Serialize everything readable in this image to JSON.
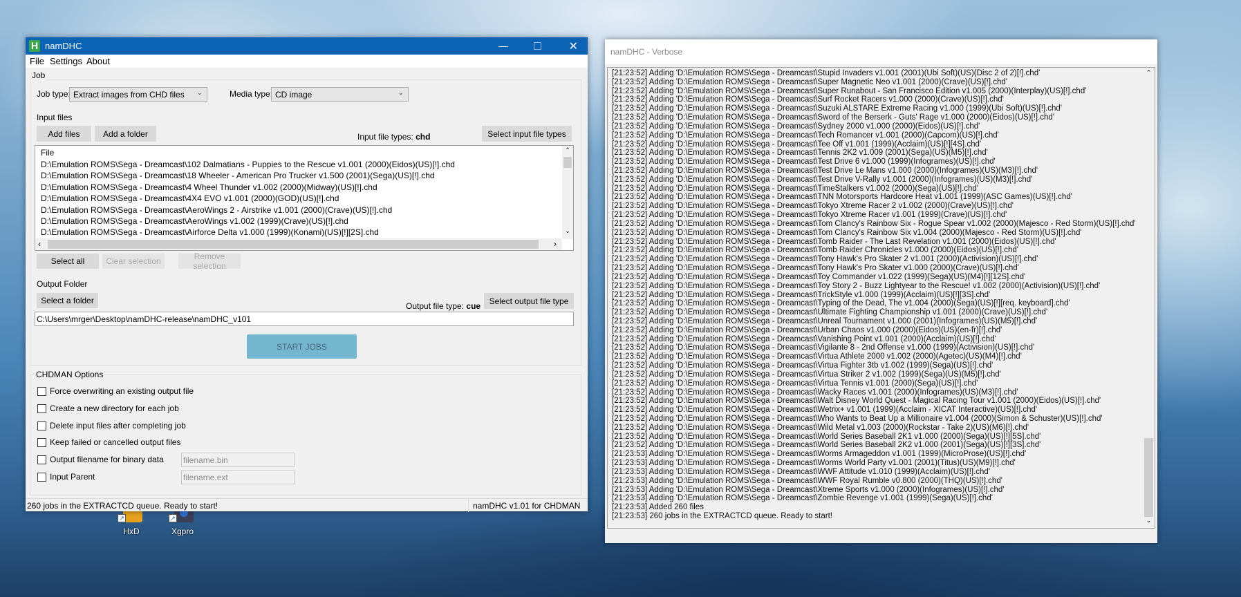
{
  "desktop": {
    "icons": [
      {
        "label": "HxD"
      },
      {
        "label": "Xgpro"
      }
    ]
  },
  "main": {
    "title": "namDHC",
    "app_icon_letter": "H",
    "menu": [
      "File",
      "Settings",
      "About"
    ],
    "job_group": "Job",
    "job_type_label": "Job type:",
    "job_type_value": "Extract images from CHD files",
    "media_type_label": "Media type:",
    "media_type_value": "CD image",
    "input_files_label": "Input files",
    "add_files": "Add files",
    "add_folder": "Add a folder",
    "input_types_label": "Input file types:",
    "input_types_value": "chd",
    "select_input_types": "Select input file types",
    "list_header": "File",
    "files": [
      "D:\\Emulation ROMS\\Sega - Dreamcast\\102 Dalmatians - Puppies to the Rescue v1.001 (2000)(Eidos)(US)[!].chd",
      "D:\\Emulation ROMS\\Sega - Dreamcast\\18 Wheeler - American Pro Trucker v1.500 (2001)(Sega)(US)[!].chd",
      "D:\\Emulation ROMS\\Sega - Dreamcast\\4 Wheel Thunder v1.002 (2000)(Midway)(US)[!].chd",
      "D:\\Emulation ROMS\\Sega - Dreamcast\\4X4 EVO v1.001 (2000)(GOD)(US)[!].chd",
      "D:\\Emulation ROMS\\Sega - Dreamcast\\AeroWings 2 - Airstrike v1.001 (2000)(Crave)(US)[!].chd",
      "D:\\Emulation ROMS\\Sega - Dreamcast\\AeroWings v1.002 (1999)(Crave)(US)[!].chd",
      "D:\\Emulation ROMS\\Sega - Dreamcast\\Airforce Delta v1.000 (1999)(Konami)(US)[!][2S].chd"
    ],
    "select_all": "Select all",
    "clear_selection": "Clear selection",
    "remove_selection": "Remove selection",
    "output_folder_label": "Output Folder",
    "select_folder": "Select a folder",
    "output_type_label": "Output file type:",
    "output_type_value": "cue",
    "select_output_type": "Select output file type",
    "output_path": "C:\\Users\\mrger\\Desktop\\namDHC-release\\namDHC_v101",
    "start_jobs": "START JOBS",
    "start_color": "#75b6cf",
    "options_group": "CHDMAN Options",
    "options": [
      {
        "label": "Force overwriting an existing output file",
        "checked": false
      },
      {
        "label": "Create a new directory for each job",
        "checked": false
      },
      {
        "label": "Delete input files after completing job",
        "checked": false
      },
      {
        "label": "Keep failed or cancelled output files",
        "checked": false
      },
      {
        "label": "Output filename for binary data",
        "checked": false,
        "field": "filename.bin"
      },
      {
        "label": "Input Parent",
        "checked": false,
        "field": "filename.ext"
      }
    ],
    "status_left": "260 jobs in the EXTRACTCD queue. Ready to start!",
    "status_right": "namDHC v1.01 for CHDMAN",
    "title_color": "#0b63b6"
  },
  "verbose": {
    "title": "namDHC - Verbose",
    "lines": [
      "[21:23:52]  Adding 'D:\\Emulation ROMS\\Sega - Dreamcast\\Stupid Invaders v1.001 (2001)(Ubi Soft)(US)(Disc 2 of 2)[!].chd'",
      "[21:23:52]  Adding 'D:\\Emulation ROMS\\Sega - Dreamcast\\Super Magnetic Neo v1.001 (2000)(Crave)(US)[!].chd'",
      "[21:23:52]  Adding 'D:\\Emulation ROMS\\Sega - Dreamcast\\Super Runabout - San Francisco Edition v1.005 (2000)(Interplay)(US)[!].chd'",
      "[21:23:52]  Adding 'D:\\Emulation ROMS\\Sega - Dreamcast\\Surf Rocket Racers v1.000 (2000)(Crave)(US)[!].chd'",
      "[21:23:52]  Adding 'D:\\Emulation ROMS\\Sega - Dreamcast\\Suzuki ALSTARE Extreme Racing v1.000 (1999)(Ubi Soft)(US)[!].chd'",
      "[21:23:52]  Adding 'D:\\Emulation ROMS\\Sega - Dreamcast\\Sword of the Berserk - Guts' Rage v1.000 (2000)(Eidos)(US)[!].chd'",
      "[21:23:52]  Adding 'D:\\Emulation ROMS\\Sega - Dreamcast\\Sydney 2000 v1.000 (2000)(Eidos)(US)[!].chd'",
      "[21:23:52]  Adding 'D:\\Emulation ROMS\\Sega - Dreamcast\\Tech Romancer v1.001 (2000)(Capcom)(US)[!].chd'",
      "[21:23:52]  Adding 'D:\\Emulation ROMS\\Sega - Dreamcast\\Tee Off v1.001 (1999)(Acclaim)(US)[!][4S].chd'",
      "[21:23:52]  Adding 'D:\\Emulation ROMS\\Sega - Dreamcast\\Tennis 2K2 v1.009 (2001)(Sega)(US)(M5)[!].chd'",
      "[21:23:52]  Adding 'D:\\Emulation ROMS\\Sega - Dreamcast\\Test Drive 6 v1.000 (1999)(Infogrames)(US)[!].chd'",
      "[21:23:52]  Adding 'D:\\Emulation ROMS\\Sega - Dreamcast\\Test Drive Le Mans v1.000 (2000)(Infogrames)(US)(M3)[!].chd'",
      "[21:23:52]  Adding 'D:\\Emulation ROMS\\Sega - Dreamcast\\Test Drive V-Rally v1.001 (2000)(Infogrames)(US)(M3)[!].chd'",
      "[21:23:52]  Adding 'D:\\Emulation ROMS\\Sega - Dreamcast\\TimeStalkers v1.002 (2000)(Sega)(US)[!].chd'",
      "[21:23:52]  Adding 'D:\\Emulation ROMS\\Sega - Dreamcast\\TNN Motorsports Hardcore Heat v1.001 (1999)(ASC Games)(US)[!].chd'",
      "[21:23:52]  Adding 'D:\\Emulation ROMS\\Sega - Dreamcast\\Tokyo Xtreme Racer 2 v1.002 (2000)(Crave)(US)[!].chd'",
      "[21:23:52]  Adding 'D:\\Emulation ROMS\\Sega - Dreamcast\\Tokyo Xtreme Racer v1.001 (1999)(Crave)(US)[!].chd'",
      "[21:23:52]  Adding 'D:\\Emulation ROMS\\Sega - Dreamcast\\Tom Clancy's Rainbow Six - Rogue Spear v1.002 (2000)(Majesco - Red Storm)(US)[!].chd'",
      "[21:23:52]  Adding 'D:\\Emulation ROMS\\Sega - Dreamcast\\Tom Clancy's Rainbow Six v1.004 (2000)(Majesco - Red Storm)(US)[!].chd'",
      "[21:23:52]  Adding 'D:\\Emulation ROMS\\Sega - Dreamcast\\Tomb Raider - The Last Revelation v1.001 (2000)(Eidos)(US)[!].chd'",
      "[21:23:52]  Adding 'D:\\Emulation ROMS\\Sega - Dreamcast\\Tomb Raider Chronicles v1.000 (2000)(Eidos)(US)[!].chd'",
      "[21:23:52]  Adding 'D:\\Emulation ROMS\\Sega - Dreamcast\\Tony Hawk's Pro Skater 2 v1.001 (2000)(Activision)(US)[!].chd'",
      "[21:23:52]  Adding 'D:\\Emulation ROMS\\Sega - Dreamcast\\Tony Hawk's Pro Skater v1.000 (2000)(Crave)(US)[!].chd'",
      "[21:23:52]  Adding 'D:\\Emulation ROMS\\Sega - Dreamcast\\Toy Commander v1.022 (1999)(Sega)(US)(M4)[!][12S].chd'",
      "[21:23:52]  Adding 'D:\\Emulation ROMS\\Sega - Dreamcast\\Toy Story 2 - Buzz Lightyear to the Rescue! v1.002 (2000)(Activision)(US)[!].chd'",
      "[21:23:52]  Adding 'D:\\Emulation ROMS\\Sega - Dreamcast\\TrickStyle v1.000 (1999)(Acclaim)(US)[!][3S].chd'",
      "[21:23:52]  Adding 'D:\\Emulation ROMS\\Sega - Dreamcast\\Typing of the Dead, The v1.004 (2000)(Sega)(US)[!][req. keyboard].chd'",
      "[21:23:52]  Adding 'D:\\Emulation ROMS\\Sega - Dreamcast\\Ultimate Fighting Championship v1.001 (2000)(Crave)(US)[!].chd'",
      "[21:23:52]  Adding 'D:\\Emulation ROMS\\Sega - Dreamcast\\Unreal Tournament v1.000 (2001)(Infogrames)(US)(M5)[!].chd'",
      "[21:23:52]  Adding 'D:\\Emulation ROMS\\Sega - Dreamcast\\Urban Chaos v1.000 (2000)(Eidos)(US)(en-fr)[!].chd'",
      "[21:23:52]  Adding 'D:\\Emulation ROMS\\Sega - Dreamcast\\Vanishing Point v1.001 (2000)(Acclaim)(US)[!].chd'",
      "[21:23:52]  Adding 'D:\\Emulation ROMS\\Sega - Dreamcast\\Vigilante 8 - 2nd Offense v1.000 (1999)(Activision)(US)[!].chd'",
      "[21:23:52]  Adding 'D:\\Emulation ROMS\\Sega - Dreamcast\\Virtua Athlete 2000 v1.002 (2000)(Agetec)(US)(M4)[!].chd'",
      "[21:23:52]  Adding 'D:\\Emulation ROMS\\Sega - Dreamcast\\Virtua Fighter 3tb v1.002 (1999)(Sega)(US)[!].chd'",
      "[21:23:52]  Adding 'D:\\Emulation ROMS\\Sega - Dreamcast\\Virtua Striker 2 v1.002 (1999)(Sega)(US)(M5)[!].chd'",
      "[21:23:52]  Adding 'D:\\Emulation ROMS\\Sega - Dreamcast\\Virtua Tennis v1.001 (2000)(Sega)(US)[!].chd'",
      "[21:23:52]  Adding 'D:\\Emulation ROMS\\Sega - Dreamcast\\Wacky Races v1.001 (2000)(Infogrames)(US)(M3)[!].chd'",
      "[21:23:52]  Adding 'D:\\Emulation ROMS\\Sega - Dreamcast\\Walt Disney World Quest - Magical Racing Tour v1.001 (2000)(Eidos)(US)[!].chd'",
      "[21:23:52]  Adding 'D:\\Emulation ROMS\\Sega - Dreamcast\\Wetrix+ v1.001 (1999)(Acclaim - XICAT Interactive)(US)[!].chd'",
      "[21:23:52]  Adding 'D:\\Emulation ROMS\\Sega - Dreamcast\\Who Wants to Beat Up a Millionaire v1.004 (2000)(Simon & Schuster)(US)[!].chd'",
      "[21:23:52]  Adding 'D:\\Emulation ROMS\\Sega - Dreamcast\\Wild Metal v1.003 (2000)(Rockstar - Take 2)(US)(M6)[!].chd'",
      "[21:23:52]  Adding 'D:\\Emulation ROMS\\Sega - Dreamcast\\World Series Baseball 2K1 v1.000 (2000)(Sega)(US)[!][5S].chd'",
      "[21:23:52]  Adding 'D:\\Emulation ROMS\\Sega - Dreamcast\\World Series Baseball 2K2 v1.000 (2001)(Sega)(US)[!][3S].chd'",
      "[21:23:53]  Adding 'D:\\Emulation ROMS\\Sega - Dreamcast\\Worms Armageddon v1.001 (1999)(MicroProse)(US)[!].chd'",
      "[21:23:53]  Adding 'D:\\Emulation ROMS\\Sega - Dreamcast\\Worms World Party v1.001 (2001)(Titus)(US)(M9)[!].chd'",
      "[21:23:53]  Adding 'D:\\Emulation ROMS\\Sega - Dreamcast\\WWF Attitude v1.010 (1999)(Acclaim)(US)[!].chd'",
      "[21:23:53]  Adding 'D:\\Emulation ROMS\\Sega - Dreamcast\\WWF Royal Rumble v0.800 (2000)(THQ)(US)[!].chd'",
      "[21:23:53]  Adding 'D:\\Emulation ROMS\\Sega - Dreamcast\\Xtreme Sports v1.000 (2000)(Infogrames)(US)[!].chd'",
      "[21:23:53]  Adding 'D:\\Emulation ROMS\\Sega - Dreamcast\\Zombie Revenge v1.001 (1999)(Sega)(US)[!].chd'",
      "[21:23:53]  Added 260 files",
      "[21:23:53]  260 jobs in the EXTRACTCD queue. Ready to start!"
    ]
  }
}
